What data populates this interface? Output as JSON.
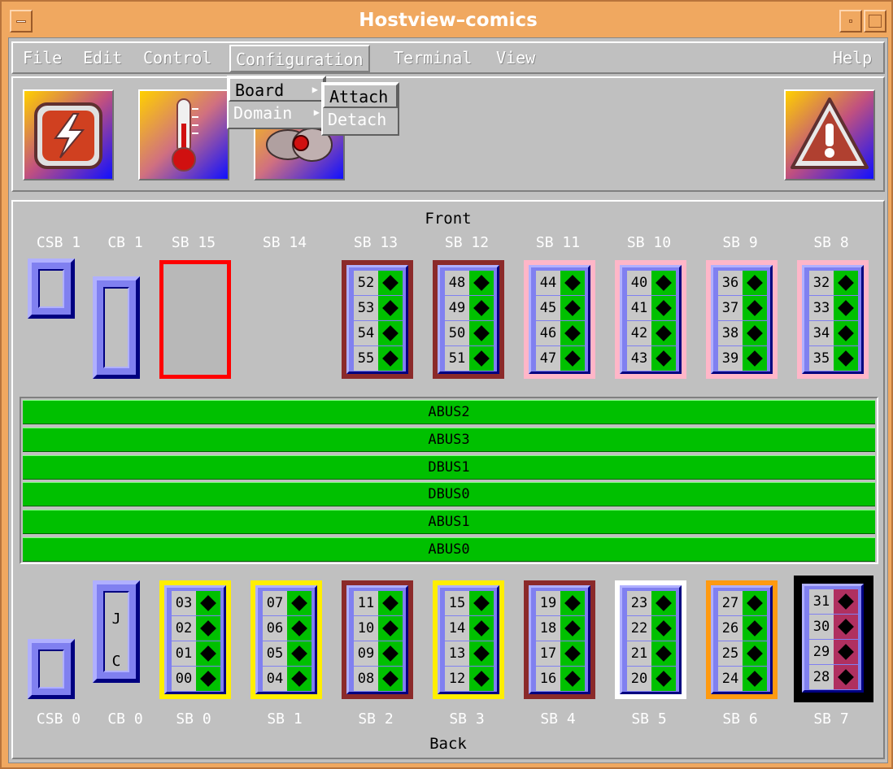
{
  "window": {
    "title": "Hostview–comics"
  },
  "menu": {
    "file": "File",
    "edit": "Edit",
    "control": "Control",
    "configuration": "Configuration",
    "terminal": "Terminal",
    "view": "View",
    "help": "Help"
  },
  "config_menu": {
    "board": "Board",
    "domain": "Domain"
  },
  "board_submenu": {
    "attach": "Attach",
    "detach": "Detach"
  },
  "toolbar": {
    "icons": [
      "power-icon",
      "thermometer-icon",
      "fan-icon",
      "warning-icon"
    ]
  },
  "chassis": {
    "front_label": "Front",
    "back_label": "Back",
    "front_slots": [
      {
        "label": "CSB 1"
      },
      {
        "label": "CB 1"
      },
      {
        "label": "SB 15"
      },
      {
        "label": "SB 14"
      },
      {
        "label": "SB 13"
      },
      {
        "label": "SB 12"
      },
      {
        "label": "SB 11"
      },
      {
        "label": "SB 10"
      },
      {
        "label": "SB 9"
      },
      {
        "label": "SB 8"
      }
    ],
    "back_slots": [
      {
        "label": "CSB 0"
      },
      {
        "label": "CB 0"
      },
      {
        "label": "SB 0"
      },
      {
        "label": "SB 1"
      },
      {
        "label": "SB 2"
      },
      {
        "label": "SB 3"
      },
      {
        "label": "SB 4"
      },
      {
        "label": "SB 5"
      },
      {
        "label": "SB 6"
      },
      {
        "label": "SB 7"
      }
    ],
    "front_boards": [
      {
        "slot": "SB 13",
        "frame": "#8b2a2a",
        "cpus": [
          "52",
          "53",
          "54",
          "55"
        ],
        "status": "green"
      },
      {
        "slot": "SB 12",
        "frame": "#8b2a2a",
        "cpus": [
          "48",
          "49",
          "50",
          "51"
        ],
        "status": "green"
      },
      {
        "slot": "SB 11",
        "frame": "#ffb6c8",
        "cpus": [
          "44",
          "45",
          "46",
          "47"
        ],
        "status": "green"
      },
      {
        "slot": "SB 10",
        "frame": "#ffb6c8",
        "cpus": [
          "40",
          "41",
          "42",
          "43"
        ],
        "status": "green"
      },
      {
        "slot": "SB 9",
        "frame": "#ffb6c8",
        "cpus": [
          "36",
          "37",
          "38",
          "39"
        ],
        "status": "green"
      },
      {
        "slot": "SB 8",
        "frame": "#ffb6c8",
        "cpus": [
          "32",
          "33",
          "34",
          "35"
        ],
        "status": "green"
      }
    ],
    "back_boards": [
      {
        "slot": "SB 0",
        "frame": "#ffee00",
        "cpus": [
          "03",
          "02",
          "01",
          "00"
        ],
        "status": "green"
      },
      {
        "slot": "SB 1",
        "frame": "#ffee00",
        "cpus": [
          "07",
          "06",
          "05",
          "04"
        ],
        "status": "green"
      },
      {
        "slot": "SB 2",
        "frame": "#8b2a2a",
        "cpus": [
          "11",
          "10",
          "09",
          "08"
        ],
        "status": "green"
      },
      {
        "slot": "SB 3",
        "frame": "#ffee00",
        "cpus": [
          "15",
          "14",
          "13",
          "12"
        ],
        "status": "green"
      },
      {
        "slot": "SB 4",
        "frame": "#8b2a2a",
        "cpus": [
          "19",
          "18",
          "17",
          "16"
        ],
        "status": "green"
      },
      {
        "slot": "SB 5",
        "frame": "#ffffff",
        "cpus": [
          "23",
          "22",
          "21",
          "20"
        ],
        "status": "green"
      },
      {
        "slot": "SB 6",
        "frame": "#ff9a10",
        "cpus": [
          "27",
          "26",
          "25",
          "24"
        ],
        "status": "green"
      },
      {
        "slot": "SB 7",
        "frame": "#000000",
        "cpus": [
          "31",
          "30",
          "29",
          "28"
        ],
        "status": "red"
      }
    ],
    "cb0_letters": {
      "j": "J",
      "c": "C"
    },
    "empty_board_frame": "#ff0000",
    "buses": [
      "ABUS2",
      "ABUS3",
      "DBUS1",
      "DBUS0",
      "ABUS1",
      "ABUS0"
    ]
  }
}
